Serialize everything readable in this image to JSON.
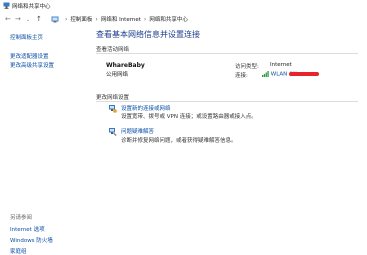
{
  "window": {
    "title": "网络和共享中心"
  },
  "address": {
    "breadcrumbs": [
      "控制面板",
      "网络和 Internet",
      "网络和共享中心"
    ],
    "separator": "›"
  },
  "sidebar": {
    "links": [
      "控制面板主页",
      "更改适配器设置",
      "更改高级共享设置"
    ],
    "see_also_title": "另请参阅",
    "see_also": [
      "Internet 选项",
      "Windows 防火墙",
      "家庭组"
    ]
  },
  "main": {
    "title": "查看基本网络信息并设置连接",
    "active_networks_label": "查看活动网络",
    "network": {
      "name": "WhareBaby",
      "type": "公用网络",
      "access_type_label": "访问类型:",
      "access_type_value": "Internet",
      "connection_label": "连接:",
      "connection_value": "WLAN (W"
    },
    "change_settings_label": "更改网络设置",
    "tasks": [
      {
        "link": "设置新的连接或网络",
        "desc": "设置宽带、拨号或 VPN 连接；或设置路由器或接入点。"
      },
      {
        "link": "问题疑难解答",
        "desc": "诊断并修复网络问题，或者获得疑难解答信息。"
      }
    ]
  },
  "colors": {
    "link": "#0b4ea8",
    "title": "#1e3d8f",
    "redaction": "#e8232b"
  }
}
